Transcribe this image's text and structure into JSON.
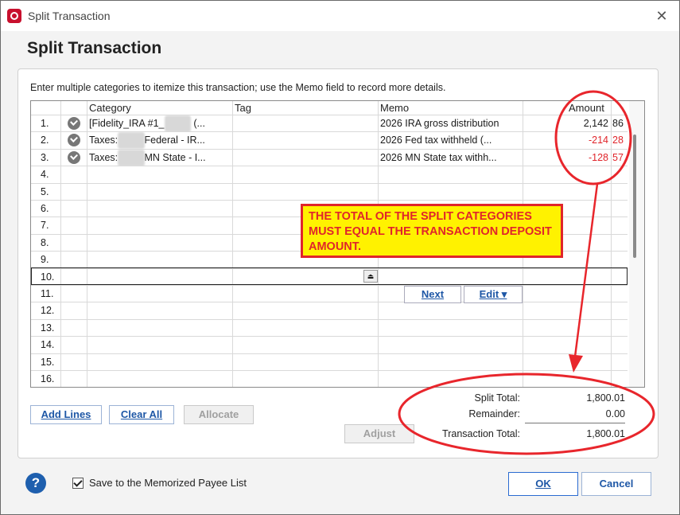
{
  "window": {
    "title": "Split Transaction",
    "close_glyph": "✕"
  },
  "heading": "Split Transaction",
  "instructions": "Enter multiple categories to itemize this transaction; use the Memo field to record more details.",
  "grid": {
    "headers": {
      "category": "Category",
      "tag": "Tag",
      "memo": "Memo",
      "amount": "Amount"
    },
    "rows": [
      {
        "num": "1.",
        "category_pre": "[Fidelity_IRA #1_",
        "category_blur": "Glenn",
        "category_post": " (...",
        "memo": "2026 IRA gross distribution",
        "amount": "2,142",
        "cents": "86",
        "negative": false,
        "checked": true
      },
      {
        "num": "2.",
        "category_pre": "Taxes:",
        "category_blur": "Glenn",
        "category_post": "Federal - IR...",
        "memo": "2026 Fed tax withheld (...",
        "amount": "-214",
        "cents": "28",
        "negative": true,
        "checked": true
      },
      {
        "num": "3.",
        "category_pre": "Taxes:",
        "category_blur": "Glenn",
        "category_post": "MN State - I...",
        "memo": "2026 MN State tax withh...",
        "amount": "-128",
        "cents": "57",
        "negative": true,
        "checked": true
      },
      {
        "num": "4."
      },
      {
        "num": "5."
      },
      {
        "num": "6."
      },
      {
        "num": "7."
      },
      {
        "num": "8."
      },
      {
        "num": "9."
      },
      {
        "num": "10."
      },
      {
        "num": "11."
      },
      {
        "num": "12."
      },
      {
        "num": "13."
      },
      {
        "num": "14."
      },
      {
        "num": "15."
      },
      {
        "num": "16."
      }
    ],
    "next_label": "Next",
    "edit_label": "Edit ▾",
    "dropdown_glyph": "⏏"
  },
  "buttons": {
    "add_lines": "Add Lines",
    "clear_all": "Clear All",
    "allocate": "Allocate",
    "adjust": "Adjust",
    "ok": "OK",
    "cancel": "Cancel"
  },
  "totals": {
    "split_total_label": "Split Total:",
    "split_total": "1,800.01",
    "remainder_label": "Remainder:",
    "remainder": "0.00",
    "transaction_total_label": "Transaction Total:",
    "transaction_total": "1,800.01"
  },
  "callout": "THE TOTAL OF THE SPLIT CATEGORIES MUST EQUAL THE TRANSACTION DEPOSIT AMOUNT.",
  "footer": {
    "help_glyph": "?",
    "memorize_label": "Save to the Memorized Payee List",
    "memorize_checked": true
  },
  "colors": {
    "accent": "#1e57a6",
    "negative": "#e0252b",
    "callout_bg": "#fff200"
  }
}
